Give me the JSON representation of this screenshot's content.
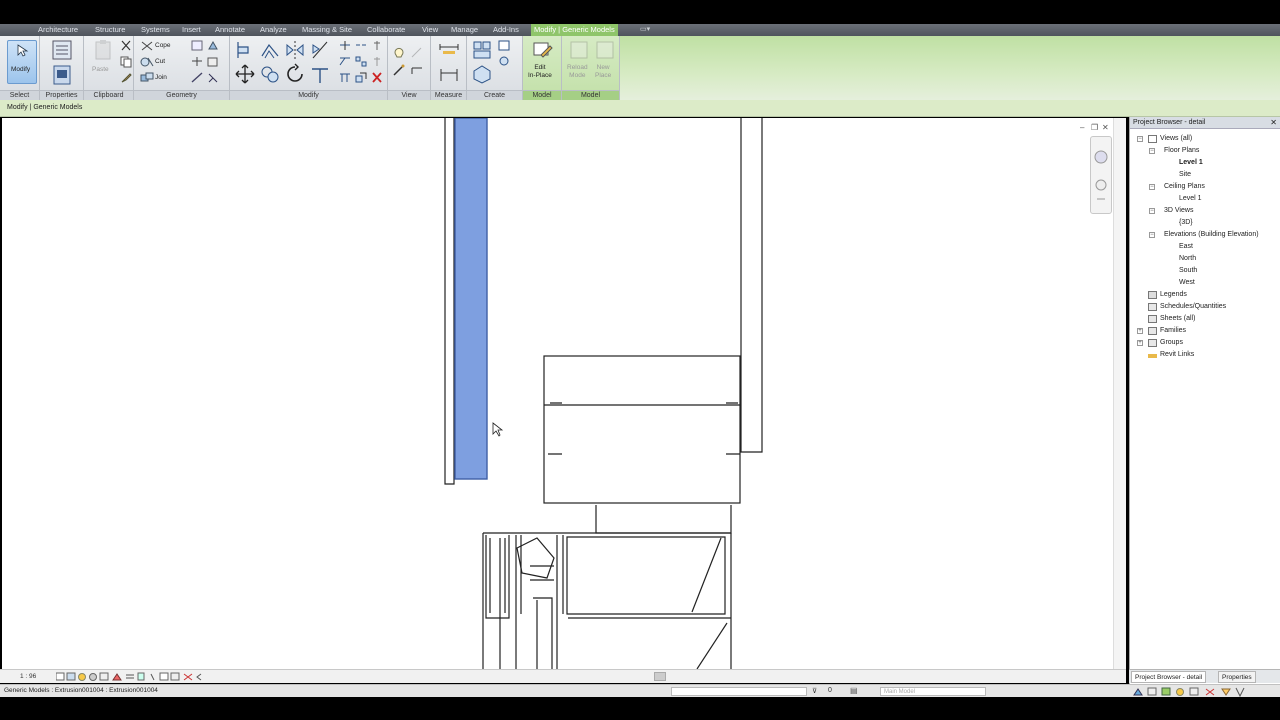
{
  "tabs": [
    "Architecture",
    "Structure",
    "Systems",
    "Insert",
    "Annotate",
    "Analyze",
    "Massing & Site",
    "Collaborate",
    "View",
    "Manage",
    "Add-Ins",
    "Modify | Generic Models"
  ],
  "ribbon": {
    "modify_label": "Modify",
    "clipboard": {
      "paste_label": "Paste"
    },
    "geometry": {
      "cope_label": "Cope",
      "cut_label": "Cut",
      "join_label": "Join"
    },
    "model": {
      "edit_in_place_label": "Edit\nIn-Place",
      "reload_mode_label": "Reload\nMode",
      "new_place_label": "New\nPlace"
    },
    "panels": [
      "Select",
      "Properties",
      "Clipboard",
      "Geometry",
      "Modify",
      "View",
      "Measure",
      "Create",
      "Model",
      "Model"
    ]
  },
  "option_bar": {
    "context": "Modify | Generic Models"
  },
  "view_control": {
    "scale": "1 : 96"
  },
  "status_bar": {
    "message": "Generic Models : Extrusion001004 : Extrusion001004",
    "sel_count": "0",
    "workset": "Main Model"
  },
  "project_browser": {
    "title": "Project Browser - detail",
    "items": [
      {
        "label": "Views (all)",
        "depth": 0,
        "toggle": "−",
        "icon": "views-icon"
      },
      {
        "label": "Floor Plans",
        "depth": 1,
        "toggle": "−"
      },
      {
        "label": "Level 1",
        "depth": 2,
        "selected": true
      },
      {
        "label": "Site",
        "depth": 2
      },
      {
        "label": "Ceiling Plans",
        "depth": 1,
        "toggle": "−"
      },
      {
        "label": "Level 1",
        "depth": 2
      },
      {
        "label": "3D Views",
        "depth": 1,
        "toggle": "−"
      },
      {
        "label": "{3D}",
        "depth": 2
      },
      {
        "label": "Elevations (Building Elevation)",
        "depth": 1,
        "toggle": "−"
      },
      {
        "label": "East",
        "depth": 2
      },
      {
        "label": "North",
        "depth": 2
      },
      {
        "label": "South",
        "depth": 2
      },
      {
        "label": "West",
        "depth": 2
      },
      {
        "label": "Legends",
        "depth": 0,
        "icon": "legend-icon"
      },
      {
        "label": "Schedules/Quantities",
        "depth": 0,
        "icon": "schedule-icon"
      },
      {
        "label": "Sheets (all)",
        "depth": 0,
        "icon": "sheet-icon"
      },
      {
        "label": "Families",
        "depth": 0,
        "toggle": "+",
        "icon": "family-icon"
      },
      {
        "label": "Groups",
        "depth": 0,
        "toggle": "+",
        "icon": "group-icon"
      },
      {
        "label": "Revit Links",
        "depth": 0,
        "icon": "link-icon"
      }
    ],
    "tabs": [
      "Project Browser - detail",
      "Properties"
    ]
  },
  "colors": {
    "selection": "#7e9fe0",
    "context_tab": "#8fc56a",
    "option_bar": "#dcebc8"
  }
}
